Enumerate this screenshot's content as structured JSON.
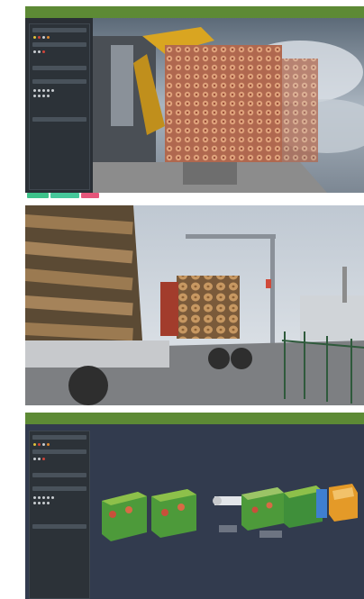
{
  "panels": [
    {
      "id": "scan-view",
      "title": "",
      "type": "scan"
    },
    {
      "id": "photo",
      "type": "photo"
    },
    {
      "id": "model-view",
      "title": "",
      "type": "model"
    }
  ],
  "buttons": [
    {
      "label": ""
    },
    {
      "label": ""
    },
    {
      "label": ""
    }
  ],
  "colors": {
    "titlebar": "#5d8a35",
    "sidebar": "#2c3238",
    "modelBg": "#323b4e",
    "accentGreen": "#3ec28a",
    "accentPink": "#e6557a"
  }
}
